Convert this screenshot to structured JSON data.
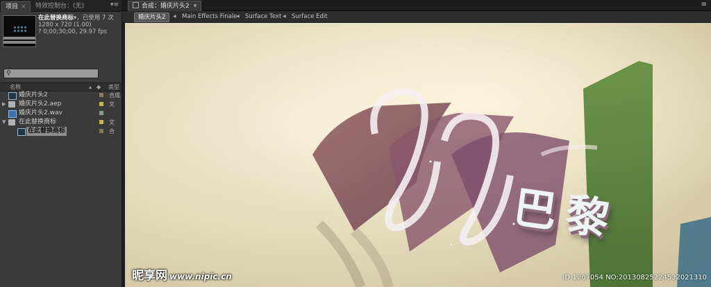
{
  "project_panel": {
    "tab_project": "项目",
    "tab_effects": "特效控制台：(无)",
    "menu_icon": "panel-menu-icon",
    "selected_item": {
      "name": "在此替换商标",
      "usage": "，已使用 7 次",
      "dimensions": "1280 x 720 (1.00)",
      "duration": "? 0;00;30;00, 29.97 fps"
    },
    "search": {
      "placeholder": "",
      "icon": "search-icon"
    },
    "columns": {
      "name": "名称",
      "label": "",
      "type": "类型"
    },
    "items": [
      {
        "name": "婚庆片头2",
        "icon": "composition-icon",
        "label_color": "#8a7a5a",
        "type": "合成",
        "twirl": ""
      },
      {
        "name": "婚庆片头2.aep",
        "icon": "folder-icon",
        "label_color": "#c8b64a",
        "type": "文",
        "twirl": "▶"
      },
      {
        "name": "婚庆片头2.wav",
        "icon": "audio-file-icon",
        "label_color": "#8a9a8a",
        "type": "",
        "twirl": ""
      },
      {
        "name": "在此替换商标",
        "icon": "folder-icon",
        "label_color": "#c8b64a",
        "type": "文",
        "twirl": "▼"
      },
      {
        "name": "在此替换商标",
        "icon": "composition-icon",
        "label_color": "#8a7a5a",
        "type": "合",
        "twirl": "",
        "child": true,
        "selected": true
      }
    ]
  },
  "composition_panel": {
    "tab_label": "合成：婚庆片头2",
    "breadcrumbs": [
      "婚庆片头2",
      "Main Effects Finale",
      "Surface Text",
      "Surface Edit"
    ],
    "menu_icon": "panel-menu-icon"
  },
  "viewer_content": {
    "scene_text": "巴黎"
  },
  "watermark": {
    "site": "昵享网",
    "url": "www.nipic.cn",
    "id": "ID:1267054 NO:20130825224532021310"
  },
  "colors": {
    "panel_bg": "#3a3a3a",
    "selection": "#8d8d8d",
    "canvas_light": "#f2ead2",
    "canvas_dark": "#cdbf9c"
  }
}
